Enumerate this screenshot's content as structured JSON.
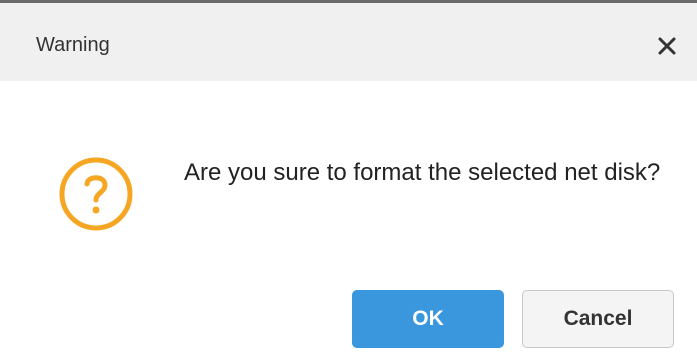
{
  "dialog": {
    "title": "Warning",
    "message": "Are you sure to format the selected net disk?",
    "icon": "question-circle-icon",
    "close_icon": "close-icon"
  },
  "buttons": {
    "ok_label": "OK",
    "cancel_label": "Cancel"
  },
  "colors": {
    "accent": "#3a96dd",
    "warning_icon": "#f5a623",
    "titlebar_bg": "#f0f0f0"
  }
}
